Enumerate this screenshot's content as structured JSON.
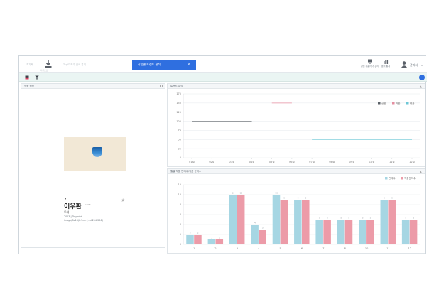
{
  "topbar": {
    "left_text": "초기화",
    "search_hint": "Tag로 작가 검색 통계",
    "active_tab": "작품별 트렌드 분석",
    "tab_close": "×",
    "download_label": "다운로드",
    "items": [
      {
        "label": "관심 작품/작가 관리",
        "icon": "monitor-icon"
      },
      {
        "label": "분석 통계",
        "icon": "stats-icon"
      }
    ],
    "admin_label": "관리자",
    "admin_caret": "▾"
  },
  "subbar": {
    "icons": [
      "book-icon",
      "filter-icon"
    ],
    "search_icon": "search-icon"
  },
  "left_panel": {
    "title": "작품 정보",
    "artwork_no": "7",
    "artist": "이우환",
    "artist_year": "1936",
    "title_line": "무제",
    "detail_1": "2013  |  Drypoint",
    "detail_2": "image(8x10)8.5cm  |  ed.214(250)"
  },
  "top_chart": {
    "title": "트렌드 분석",
    "legend": [
      {
        "label": "상한",
        "color": "#5c6269"
      },
      {
        "label": "하한",
        "color": "#e58ea0"
      },
      {
        "label": "평균",
        "color": "#6cc7d6"
      }
    ]
  },
  "bottom_chart": {
    "title": "월별 작품 판매수/작품 문의수",
    "legend": [
      {
        "label": "판매수",
        "color": "#a6d6e3"
      },
      {
        "label": "작품문의수",
        "color": "#ec9ba8"
      }
    ]
  },
  "chart_data": [
    {
      "type": "line",
      "x": [
        "01월",
        "02월",
        "03월",
        "04월",
        "05월",
        "06월",
        "07월",
        "08월",
        "09월",
        "10월",
        "11월",
        "12월"
      ],
      "ylim": [
        0,
        175
      ],
      "yticks": [
        0,
        25,
        50,
        75,
        100,
        125,
        150,
        175
      ],
      "grid": true,
      "legend_position": "top-right",
      "series": [
        {
          "name": "상한",
          "color": "#8a8f94",
          "segments": [
            {
              "from": "01월",
              "to": "04월",
              "value": 100
            }
          ]
        },
        {
          "name": "하한",
          "color": "#e58ea0",
          "segments": [
            {
              "from": "05월",
              "to": "06월",
              "value": 150
            }
          ]
        },
        {
          "name": "평균",
          "color": "#6cc7d6",
          "segments": [
            {
              "from": "07월",
              "to": "12월",
              "value": 50
            }
          ]
        }
      ]
    },
    {
      "type": "bar",
      "categories": [
        "1",
        "2",
        "3",
        "4",
        "5",
        "6",
        "7",
        "8",
        "10",
        "11",
        "12"
      ],
      "ylim": [
        0,
        12
      ],
      "yticks": [
        0,
        2,
        4,
        6,
        8,
        10,
        12
      ],
      "grid": true,
      "legend_position": "top-right",
      "series": [
        {
          "name": "판매수",
          "color": "#a6d6e3",
          "values": [
            2,
            1,
            10,
            4,
            10,
            9,
            5,
            5,
            5,
            9,
            5
          ]
        },
        {
          "name": "작품문의수",
          "color": "#ec9ba8",
          "values": [
            2,
            1,
            10,
            3,
            9,
            9,
            5,
            5,
            5,
            9,
            5
          ]
        }
      ]
    }
  ]
}
